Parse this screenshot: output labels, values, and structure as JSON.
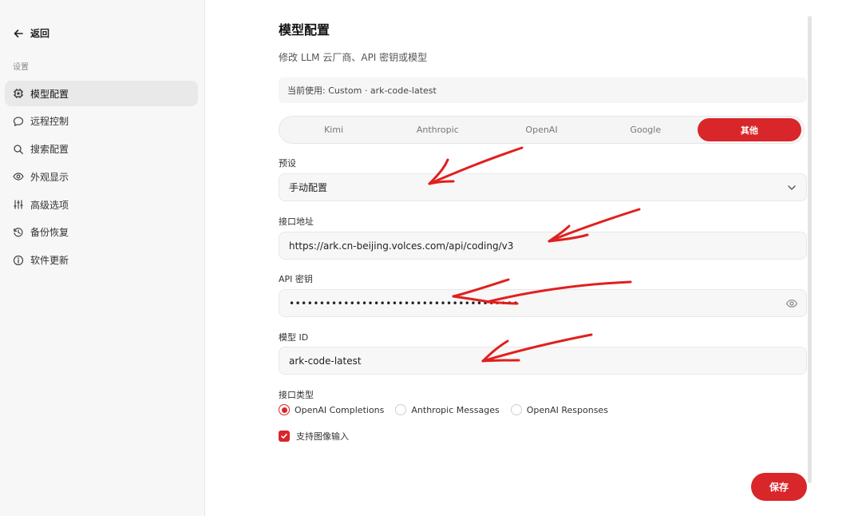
{
  "sidebar": {
    "back_label": "返回",
    "section_label": "设置",
    "items": [
      {
        "label": "模型配置",
        "icon": "chip-icon",
        "active": true
      },
      {
        "label": "远程控制",
        "icon": "chat-bubble-icon",
        "active": false
      },
      {
        "label": "搜索配置",
        "icon": "search-icon",
        "active": false
      },
      {
        "label": "外观显示",
        "icon": "eye-icon",
        "active": false
      },
      {
        "label": "高级选项",
        "icon": "sliders-icon",
        "active": false
      },
      {
        "label": "备份恢复",
        "icon": "history-icon",
        "active": false
      },
      {
        "label": "软件更新",
        "icon": "info-icon",
        "active": false
      }
    ]
  },
  "main": {
    "title": "模型配置",
    "subtitle": "修改 LLM 云厂商、API 密钥或模型",
    "current": "当前使用: Custom · ark-code-latest",
    "tabs": [
      "Kimi",
      "Anthropic",
      "OpenAI",
      "Google",
      "其他"
    ],
    "active_tab": "其他",
    "preset": {
      "label": "预设",
      "value": "手动配置"
    },
    "endpoint": {
      "label": "接口地址",
      "value": "https://ark.cn-beijing.volces.com/api/coding/v3"
    },
    "api_key": {
      "label": "API 密钥",
      "value": "••••••••••••••••••••••••••••••••••••••"
    },
    "model_id": {
      "label": "模型 ID",
      "value": "ark-code-latest"
    },
    "interface_type": {
      "label": "接口类型",
      "options": [
        "OpenAI Completions",
        "Anthropic Messages",
        "OpenAI Responses"
      ],
      "selected": "OpenAI Completions"
    },
    "image_input": {
      "label": "支持图像输入",
      "checked": true
    },
    "save_label": "保存"
  },
  "colors": {
    "accent": "#d9262a",
    "annotation": "#e0201e"
  }
}
